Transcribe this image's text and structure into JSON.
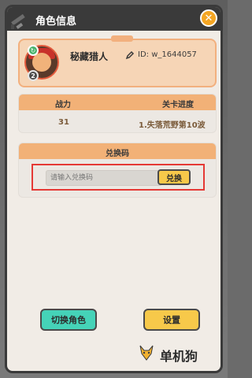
{
  "window": {
    "title": "角色信息"
  },
  "icons": {
    "header": "sword-icon",
    "close": "close-icon",
    "edit": "edit-icon",
    "sync": "sync-icon",
    "fox": "fox-icon"
  },
  "profile": {
    "name": "秘藏猎人",
    "id_text": "ID: w_1644057",
    "level": "2"
  },
  "stats": {
    "labels": [
      "战力",
      "关卡进度"
    ],
    "values": [
      "31",
      "1.失落荒野第10波"
    ]
  },
  "redeem": {
    "title": "兑换码",
    "placeholder": "请输入兑换码",
    "button_label": "兑换"
  },
  "actions": {
    "switch_label": "切换角色",
    "settings_label": "设置"
  },
  "watermark": {
    "text": "单机狗"
  },
  "colors": {
    "accent_orange": "#f2b177",
    "yellow_button": "#f7c94a",
    "teal_button": "#45d3b8",
    "highlight_red": "#e53935"
  }
}
